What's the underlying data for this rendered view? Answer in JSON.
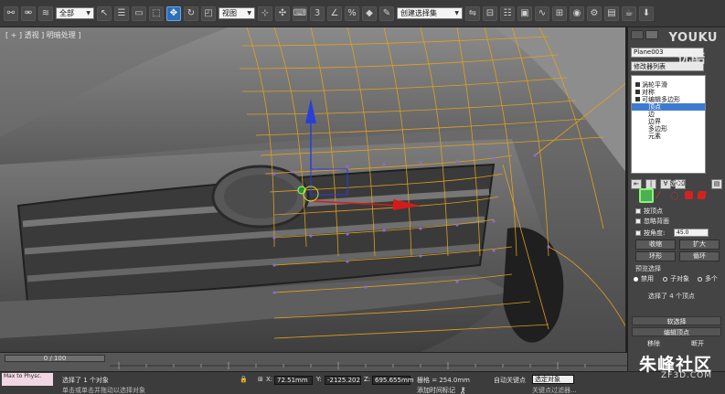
{
  "toolbar": {
    "filter_select": "全部",
    "refcoord_select": "视图",
    "named_sel_select": "创建选择集"
  },
  "viewport": {
    "label": "[ + ] 透视 ] 明暗处理 ]"
  },
  "watermark": {
    "brand_en": "YOUKU",
    "brand_cn": "优酷"
  },
  "command_panel": {
    "object_name": "Plane003",
    "modifier_list": "修改器列表",
    "stack": [
      {
        "label": "涡轮平滑",
        "indent": false
      },
      {
        "label": "对称",
        "indent": false
      },
      {
        "label": "可编辑多边形",
        "indent": false
      },
      {
        "label": "顶点",
        "indent": true,
        "selected": true
      },
      {
        "label": "边",
        "indent": true
      },
      {
        "label": "边界",
        "indent": true
      },
      {
        "label": "多边形",
        "indent": true
      },
      {
        "label": "元素",
        "indent": true
      }
    ],
    "selection": {
      "header": "选择",
      "by_vertex": "按顶点",
      "ignore_backfacing": "忽略背面",
      "by_angle": "按角度:",
      "angle_value": "45.0",
      "shrink": "收缩",
      "grow": "扩大",
      "ring": "环形",
      "loop": "循环",
      "preview_header": "预览选择",
      "preview_off": "禁用",
      "preview_sub": "子对象",
      "preview_multi": "多个",
      "status": "选择了 4 个顶点"
    },
    "soft_selection_header": "软选择",
    "edit_vertices_header": "编辑顶点",
    "remove": "移除",
    "break": "断开"
  },
  "timeline": {
    "frame": "0 / 100"
  },
  "status": {
    "maxscript": "Max to Physc.",
    "message": "选择了 1 个对象",
    "prompt": "单击或单击并拖动以选择对象",
    "x_label": "X:",
    "x_value": "72.51mm",
    "y_label": "Y:",
    "y_value": "-2125.202",
    "z_label": "Z:",
    "z_value": "695.655mm",
    "grid": "栅格 = 254.0mm",
    "auto_key": "自动关键点",
    "set_key_select": "选定对象",
    "add_time_tag": "添加时间标记",
    "key_filters": "关键点过滤器..."
  },
  "footer_logo": {
    "name": "朱峰社区",
    "url": "ZF3D.COM"
  }
}
